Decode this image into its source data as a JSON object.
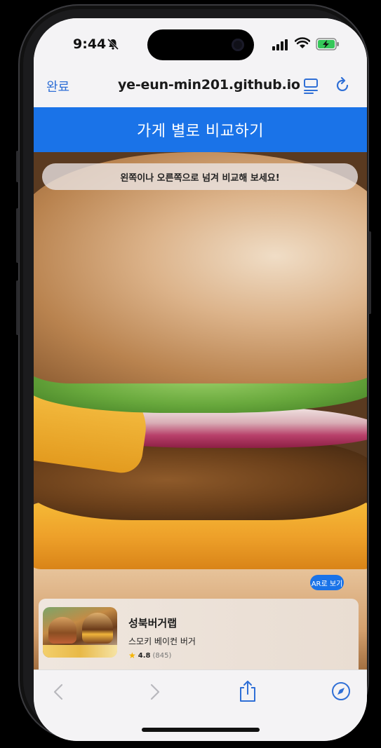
{
  "status_bar": {
    "time": "9:44",
    "icons": [
      "bell-slash-icon",
      "signal-icon",
      "wifi-icon",
      "battery-charging-icon"
    ]
  },
  "browser": {
    "done_label": "완료",
    "url": "ye-eun-min201.github.io",
    "icons": [
      "reader-icon",
      "reload-icon"
    ]
  },
  "page": {
    "header_title": "가게 별로 비교하기",
    "hint": "왼쪽이나 오른쪽으로 넘겨 비교해 보세요!",
    "ar_button": "AR로 보기"
  },
  "store_card": {
    "store_name": "성북버거랩",
    "menu_name": "스모키 베이컨 버거",
    "rating": "4.8",
    "review_count": "(845)"
  },
  "toolbar": {
    "icons": [
      "back-icon",
      "forward-icon",
      "share-icon",
      "compass-icon"
    ]
  },
  "colors": {
    "accent": "#1a73e8",
    "link": "#2f6fd6",
    "star": "#f5b400"
  }
}
